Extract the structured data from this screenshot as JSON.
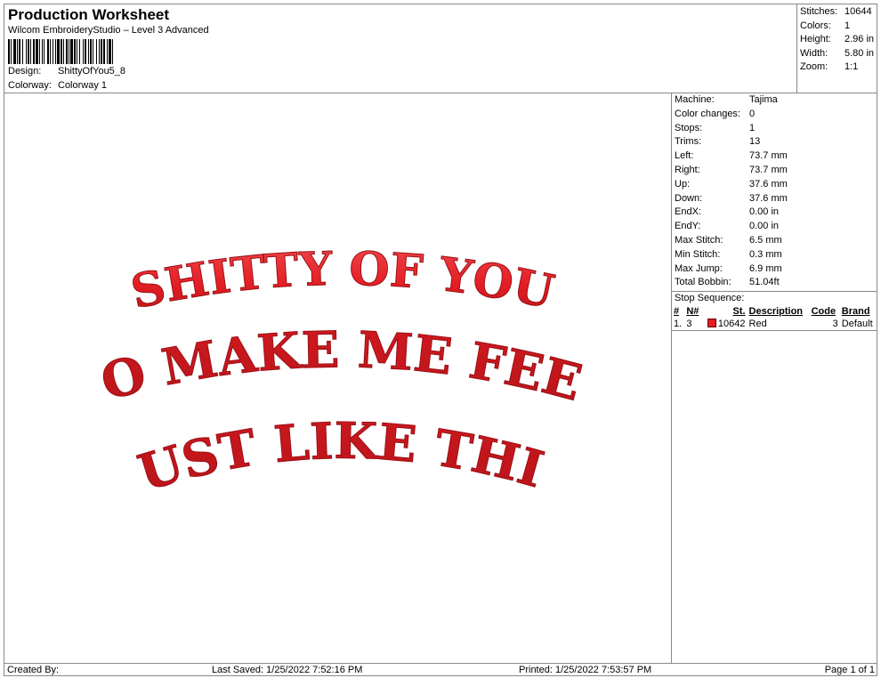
{
  "header": {
    "title": "Production Worksheet",
    "subtitle": "Wilcom EmbroideryStudio – Level 3 Advanced",
    "design_label": "Design:",
    "design_value": "ShittyOfYou5_8",
    "colorway_label": "Colorway:",
    "colorway_value": "Colorway 1"
  },
  "summary": {
    "stitches_label": "Stitches:",
    "stitches": "10644",
    "colors_label": "Colors:",
    "colors": "1",
    "height_label": "Height:",
    "height": "2.96 in",
    "width_label": "Width:",
    "width": "5.80 in",
    "zoom_label": "Zoom:",
    "zoom": "1:1"
  },
  "machine_info": [
    {
      "label": "Machine:",
      "value": "Tajima"
    },
    {
      "label": "Color changes:",
      "value": "0"
    },
    {
      "label": "Stops:",
      "value": "1"
    },
    {
      "label": "Trims:",
      "value": "13"
    },
    {
      "label": "Left:",
      "value": "73.7 mm"
    },
    {
      "label": "Right:",
      "value": "73.7 mm"
    },
    {
      "label": "Up:",
      "value": "37.6 mm"
    },
    {
      "label": "Down:",
      "value": "37.6 mm"
    },
    {
      "label": "EndX:",
      "value": "0.00 in"
    },
    {
      "label": "EndY:",
      "value": "0.00 in"
    },
    {
      "label": "Max Stitch:",
      "value": "6.5 mm"
    },
    {
      "label": "Min Stitch:",
      "value": "0.3 mm"
    },
    {
      "label": "Max Jump:",
      "value": "6.9 mm"
    },
    {
      "label": "Total Bobbin:",
      "value": "51.04ft"
    }
  ],
  "stop_sequence": {
    "title": "Stop Sequence:",
    "headers": {
      "num": "#",
      "n": "N#",
      "st": "St.",
      "description": "Description",
      "code": "Code",
      "brand": "Brand"
    },
    "rows": [
      {
        "num": "1.",
        "n": "3",
        "color": "#e31e24",
        "st": "10642",
        "description": "Red",
        "code": "3",
        "brand": "Default"
      }
    ]
  },
  "design": {
    "lines": [
      "SHITTY OF YOU",
      "TO MAKE ME FEEL",
      "JUST LIKE THIS"
    ],
    "thread_color": "#e31e24"
  },
  "footer": {
    "created_by": "Created By:",
    "last_saved": "Last Saved: 1/25/2022 7:52:16 PM",
    "printed": "Printed: 1/25/2022 7:53:57 PM",
    "page": "Page 1 of 1"
  }
}
